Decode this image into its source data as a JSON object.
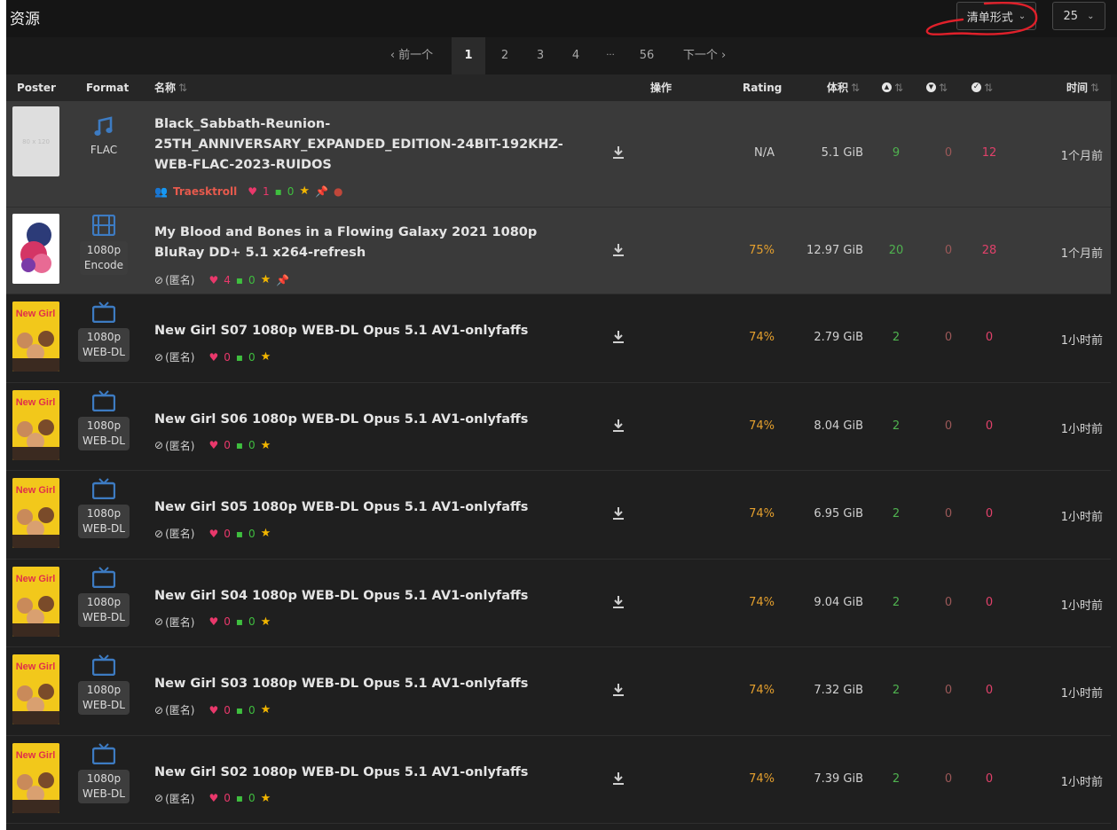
{
  "header": {
    "title": "资源",
    "view_mode": "清单形式",
    "per_page": "25"
  },
  "pagination": {
    "prev": "‹ 前一个",
    "pages": [
      "1",
      "2",
      "3",
      "4",
      "···",
      "56"
    ],
    "next": "下一个 ›",
    "current": "1"
  },
  "columns": {
    "poster": "Poster",
    "format": "Format",
    "name": "名称",
    "actions": "操作",
    "rating": "Rating",
    "size": "体积",
    "time": "时间"
  },
  "rows": [
    {
      "poster_text": "80 x 120",
      "format_icon": "music-note-icon",
      "format": [
        "FLAC"
      ],
      "name": "Black_Sabbath-Reunion-25TH_ANNIVERSARY_EXPANDED_EDITION-24BIT-192KHZ-WEB-FLAC-2023-RUIDOS",
      "uploader": "Traesktroll",
      "hearts": "1",
      "comments": "0",
      "rating": "N/A",
      "size": "5.1 GiB",
      "seeders": "9",
      "leechers": "0",
      "snatched": "12",
      "time": "1个月前"
    },
    {
      "format_icon": "film-icon",
      "format": [
        "1080p",
        "Encode"
      ],
      "name": "My Blood and Bones in a Flowing Galaxy 2021 1080p BluRay DD+ 5.1 x264-refresh",
      "uploader": "(匿名)",
      "hearts": "4",
      "comments": "0",
      "rating": "75%",
      "size": "12.97 GiB",
      "seeders": "20",
      "leechers": "0",
      "snatched": "28",
      "time": "1个月前"
    },
    {
      "poster_text": "New Girl",
      "format_icon": "tv-icon",
      "format": [
        "1080p",
        "WEB-DL"
      ],
      "name": "New Girl S07 1080p WEB-DL Opus 5.1 AV1-onlyfaffs",
      "uploader": "(匿名)",
      "hearts": "0",
      "comments": "0",
      "rating": "74%",
      "size": "2.79 GiB",
      "seeders": "2",
      "leechers": "0",
      "snatched": "0",
      "time": "1小时前"
    },
    {
      "poster_text": "New Girl",
      "format_icon": "tv-icon",
      "format": [
        "1080p",
        "WEB-DL"
      ],
      "name": "New Girl S06 1080p WEB-DL Opus 5.1 AV1-onlyfaffs",
      "uploader": "(匿名)",
      "hearts": "0",
      "comments": "0",
      "rating": "74%",
      "size": "8.04 GiB",
      "seeders": "2",
      "leechers": "0",
      "snatched": "0",
      "time": "1小时前"
    },
    {
      "poster_text": "New Girl",
      "format_icon": "tv-icon",
      "format": [
        "1080p",
        "WEB-DL"
      ],
      "name": "New Girl S05 1080p WEB-DL Opus 5.1 AV1-onlyfaffs",
      "uploader": "(匿名)",
      "hearts": "0",
      "comments": "0",
      "rating": "74%",
      "size": "6.95 GiB",
      "seeders": "2",
      "leechers": "0",
      "snatched": "0",
      "time": "1小时前"
    },
    {
      "poster_text": "New Girl",
      "format_icon": "tv-icon",
      "format": [
        "1080p",
        "WEB-DL"
      ],
      "name": "New Girl S04 1080p WEB-DL Opus 5.1 AV1-onlyfaffs",
      "uploader": "(匿名)",
      "hearts": "0",
      "comments": "0",
      "rating": "74%",
      "size": "9.04 GiB",
      "seeders": "2",
      "leechers": "0",
      "snatched": "0",
      "time": "1小时前"
    },
    {
      "poster_text": "New Girl",
      "format_icon": "tv-icon",
      "format": [
        "1080p",
        "WEB-DL"
      ],
      "name": "New Girl S03 1080p WEB-DL Opus 5.1 AV1-onlyfaffs",
      "uploader": "(匿名)",
      "hearts": "0",
      "comments": "0",
      "rating": "74%",
      "size": "7.32 GiB",
      "seeders": "2",
      "leechers": "0",
      "snatched": "0",
      "time": "1小时前"
    },
    {
      "poster_text": "New Girl",
      "format_icon": "tv-icon",
      "format": [
        "1080p",
        "WEB-DL"
      ],
      "name": "New Girl S02 1080p WEB-DL Opus 5.1 AV1-onlyfaffs",
      "uploader": "(匿名)",
      "hearts": "0",
      "comments": "0",
      "rating": "74%",
      "size": "7.39 GiB",
      "seeders": "2",
      "leechers": "0",
      "snatched": "0",
      "time": "1小时前"
    }
  ],
  "colors": {
    "accent_rating": "#e5a02e",
    "seeders": "#4fb24f",
    "snatched": "#e0416a",
    "uploader": "#e65a4d",
    "annotation": "#e0202a"
  }
}
